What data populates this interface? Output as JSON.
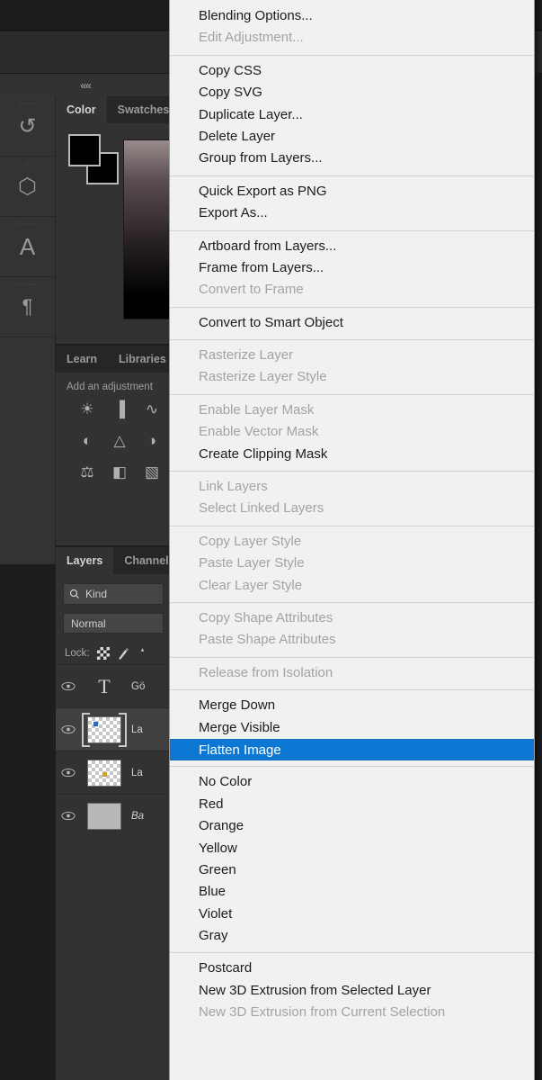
{
  "app": {
    "collapse_chevrons": "««"
  },
  "left_rail": {
    "items": [
      {
        "name": "history-panel-icon",
        "tag": "History",
        "glyph": "↺"
      },
      {
        "name": "3d-panel-icon",
        "tag": "3D",
        "glyph": "⬡"
      },
      {
        "name": "character-panel-icon",
        "tag": "Character",
        "glyph": "A"
      },
      {
        "name": "paragraph-panel-icon",
        "tag": "Paragraph",
        "glyph": "¶"
      }
    ]
  },
  "color_panel": {
    "tabs": [
      {
        "label": "Color",
        "active": true
      },
      {
        "label": "Swatches",
        "active": false
      }
    ]
  },
  "adjustments_panel": {
    "tabs": [
      {
        "label": "Learn",
        "active": false
      },
      {
        "label": "Libraries",
        "active": false
      }
    ],
    "hint": "Add an adjustment",
    "icons": [
      "brightness-contrast-icon",
      "levels-icon",
      "curves-icon",
      "exposure-icon",
      "vibrance-icon",
      "hue-saturation-icon",
      "color-balance-icon",
      "black-white-icon",
      "photo-filter-icon"
    ]
  },
  "layers_panel": {
    "tabs": [
      {
        "label": "Layers",
        "active": true
      },
      {
        "label": "Channels",
        "active": false
      }
    ],
    "filter": {
      "icon": "search-icon",
      "value": "Kind",
      "chevron": "⌄"
    },
    "blend_mode": "Normal",
    "lock": {
      "label": "Lock:",
      "icons": [
        "transparent-pixels-icon",
        "image-pixels-icon",
        "position-icon"
      ]
    },
    "rows": [
      {
        "visible": true,
        "thumb": "type",
        "glyph": "T",
        "name": "Gö",
        "selected": false,
        "italic": false
      },
      {
        "visible": true,
        "thumb": "transparent",
        "name": "La",
        "selected": true,
        "italic": false
      },
      {
        "visible": true,
        "thumb": "transparent",
        "name": "La",
        "selected": false,
        "italic": false
      },
      {
        "visible": true,
        "thumb": "solid",
        "name": "Ba",
        "selected": false,
        "italic": true
      }
    ]
  },
  "context_menu": {
    "highlight_color": "#0c78d4",
    "background_color": "#f1f1f1",
    "text_color": "#1b1b1b",
    "disabled_color": "#a3a3a3",
    "groups": [
      {
        "items": [
          {
            "label": "Blending Options...",
            "enabled": true,
            "highlighted": false
          },
          {
            "label": "Edit Adjustment...",
            "enabled": false,
            "highlighted": false
          }
        ]
      },
      {
        "items": [
          {
            "label": "Copy CSS",
            "enabled": true,
            "highlighted": false
          },
          {
            "label": "Copy SVG",
            "enabled": true,
            "highlighted": false
          },
          {
            "label": "Duplicate Layer...",
            "enabled": true,
            "highlighted": false
          },
          {
            "label": "Delete Layer",
            "enabled": true,
            "highlighted": false
          },
          {
            "label": "Group from Layers...",
            "enabled": true,
            "highlighted": false
          }
        ]
      },
      {
        "items": [
          {
            "label": "Quick Export as PNG",
            "enabled": true,
            "highlighted": false
          },
          {
            "label": "Export As...",
            "enabled": true,
            "highlighted": false
          }
        ]
      },
      {
        "items": [
          {
            "label": "Artboard from Layers...",
            "enabled": true,
            "highlighted": false
          },
          {
            "label": "Frame from Layers...",
            "enabled": true,
            "highlighted": false
          },
          {
            "label": "Convert to Frame",
            "enabled": false,
            "highlighted": false
          }
        ]
      },
      {
        "items": [
          {
            "label": "Convert to Smart Object",
            "enabled": true,
            "highlighted": false
          }
        ]
      },
      {
        "items": [
          {
            "label": "Rasterize Layer",
            "enabled": false,
            "highlighted": false
          },
          {
            "label": "Rasterize Layer Style",
            "enabled": false,
            "highlighted": false
          }
        ]
      },
      {
        "items": [
          {
            "label": "Enable Layer Mask",
            "enabled": false,
            "highlighted": false
          },
          {
            "label": "Enable Vector Mask",
            "enabled": false,
            "highlighted": false
          },
          {
            "label": "Create Clipping Mask",
            "enabled": true,
            "highlighted": false
          }
        ]
      },
      {
        "items": [
          {
            "label": "Link Layers",
            "enabled": false,
            "highlighted": false
          },
          {
            "label": "Select Linked Layers",
            "enabled": false,
            "highlighted": false
          }
        ]
      },
      {
        "items": [
          {
            "label": "Copy Layer Style",
            "enabled": false,
            "highlighted": false
          },
          {
            "label": "Paste Layer Style",
            "enabled": false,
            "highlighted": false
          },
          {
            "label": "Clear Layer Style",
            "enabled": false,
            "highlighted": false
          }
        ]
      },
      {
        "items": [
          {
            "label": "Copy Shape Attributes",
            "enabled": false,
            "highlighted": false
          },
          {
            "label": "Paste Shape Attributes",
            "enabled": false,
            "highlighted": false
          }
        ]
      },
      {
        "items": [
          {
            "label": "Release from Isolation",
            "enabled": false,
            "highlighted": false
          }
        ]
      },
      {
        "items": [
          {
            "label": "Merge Down",
            "enabled": true,
            "highlighted": false
          },
          {
            "label": "Merge Visible",
            "enabled": true,
            "highlighted": false
          },
          {
            "label": "Flatten Image",
            "enabled": true,
            "highlighted": true
          }
        ]
      },
      {
        "items": [
          {
            "label": "No Color",
            "enabled": true,
            "highlighted": false
          },
          {
            "label": "Red",
            "enabled": true,
            "highlighted": false
          },
          {
            "label": "Orange",
            "enabled": true,
            "highlighted": false
          },
          {
            "label": "Yellow",
            "enabled": true,
            "highlighted": false
          },
          {
            "label": "Green",
            "enabled": true,
            "highlighted": false
          },
          {
            "label": "Blue",
            "enabled": true,
            "highlighted": false
          },
          {
            "label": "Violet",
            "enabled": true,
            "highlighted": false
          },
          {
            "label": "Gray",
            "enabled": true,
            "highlighted": false
          }
        ]
      },
      {
        "items": [
          {
            "label": "Postcard",
            "enabled": true,
            "highlighted": false
          },
          {
            "label": "New 3D Extrusion from Selected Layer",
            "enabled": true,
            "highlighted": false
          },
          {
            "label": "New 3D Extrusion from Current Selection",
            "enabled": false,
            "highlighted": false
          }
        ]
      }
    ]
  }
}
